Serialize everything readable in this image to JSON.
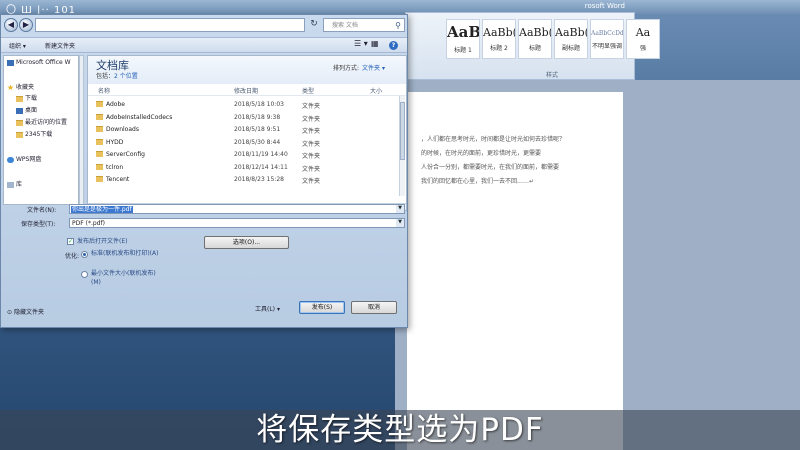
{
  "word": {
    "title": "rosoft Word",
    "styles": [
      {
        "preview": "AaBb",
        "label": "标题 1",
        "kind": "huge"
      },
      {
        "preview": "AaBb(",
        "label": "标题 2",
        "kind": "normal"
      },
      {
        "preview": "AaBb(",
        "label": "标题",
        "kind": "normal"
      },
      {
        "preview": "AaBb(",
        "label": "副标题",
        "kind": "normal"
      },
      {
        "preview": "AaBbCcDd",
        "label": "不明显强调",
        "kind": "tiny"
      },
      {
        "preview": "Aa",
        "label": "强",
        "kind": "normal"
      }
    ],
    "styles_group": "样式",
    "doc_lines": [
      "，人们都在思考时光，时间都是让时光如何去珍惜呢？",
      "的时候，在时光的面前，更珍惜时光，更需要",
      "人份合一分别，都需要时光，在我们的面前，都需要",
      "我们的回忆都在心里，我们一去不回……↵"
    ]
  },
  "dialog": {
    "search_placeholder": "搜索 文档",
    "toolbar": {
      "organize": "组织 ▾",
      "new_folder": "新建文件夹",
      "view": "☰ ▾",
      "view2": "▦",
      "help": "?"
    },
    "nav": {
      "top_item": "Microsoft Office W",
      "favorites": "收藏夹",
      "items": [
        "下载",
        "桌面",
        "最近访问的位置",
        "2345下载"
      ],
      "wps": "WPS网盘",
      "libraries": "库"
    },
    "library": {
      "title": "文档库",
      "subtitle_prefix": "包括：",
      "subtitle_link": "2 个位置",
      "arrange_label": "排列方式:",
      "arrange_value": "文件夹 ▾"
    },
    "columns": {
      "name": "名称",
      "date": "修改日期",
      "type": "类型",
      "size": "大小"
    },
    "files": [
      {
        "name": "Adobe",
        "date": "2018/5/18 10:03",
        "type": "文件夹"
      },
      {
        "name": "AdobeInstalledCodecs",
        "date": "2018/5/18 9:38",
        "type": "文件夹"
      },
      {
        "name": "Downloads",
        "date": "2018/5/18 9:51",
        "type": "文件夹"
      },
      {
        "name": "HYDD",
        "date": "2018/5/30 8:44",
        "type": "文件夹"
      },
      {
        "name": "ServerConfig",
        "date": "2018/11/19 14:40",
        "type": "文件夹"
      },
      {
        "name": "tclron",
        "date": "2018/12/14 14:11",
        "type": "文件夹"
      },
      {
        "name": "Tencent",
        "date": "2018/8/23 15:28",
        "type": "文件夹"
      }
    ],
    "filename_label": "文件名(N):",
    "filename_value": "你出是是极为一件.pdf",
    "filetype_label": "保存类型(T):",
    "filetype_value": "PDF (*.pdf)",
    "open_after_label": "发布后打开文件(E)",
    "options_button": "选项(O)...",
    "optimize_label": "优化:",
    "optimize_standard": "标准(联机发布和打印)(A)",
    "optimize_min": "最小文件大小(联机发布)(M)",
    "hide_folders": "隐藏文件夹",
    "tools_label": "工具(L)",
    "publish_button": "发布(S)",
    "cancel_button": "取消"
  },
  "subtitle": "将保存类型选为PDF"
}
